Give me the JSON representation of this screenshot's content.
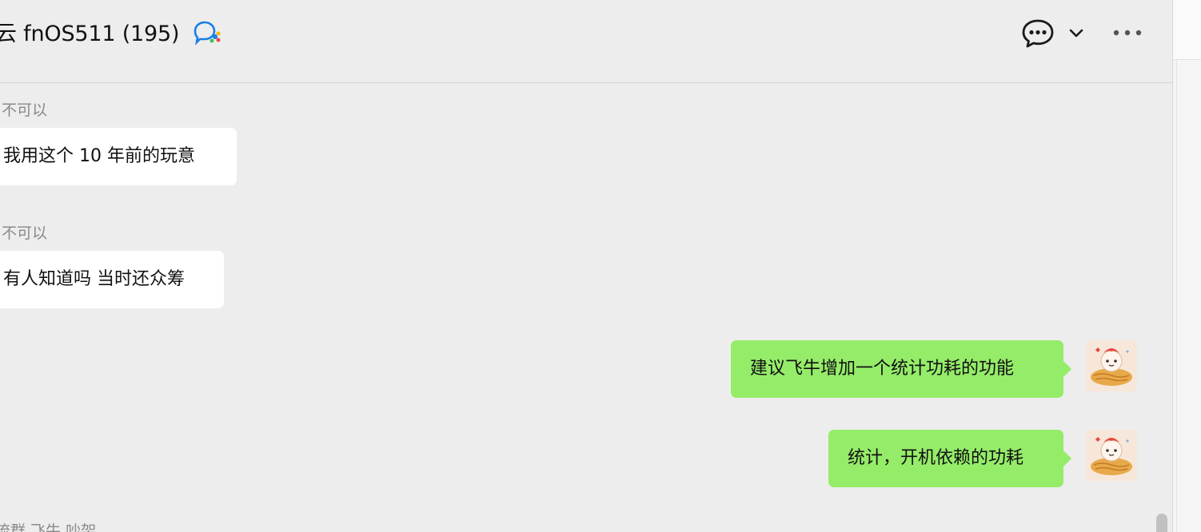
{
  "header": {
    "title": "云 fnOS511 (195)",
    "group_badge_icon": "group-chat-badge-icon",
    "chat_icon": "chat-bubble-icon",
    "chevron_icon": "chevron-down-icon",
    "more_icon": "more-horizontal-icon"
  },
  "messages": [
    {
      "direction": "in",
      "sender": "不可以",
      "text": "我用这个  10 年前的玩意"
    },
    {
      "direction": "in",
      "sender": "不可以",
      "text": "有人知道吗 当时还众筹"
    },
    {
      "direction": "out",
      "text": "建议飞牛增加一个统计功耗的功能",
      "avatar_icon": "peanut-cat-avatar-icon"
    },
    {
      "direction": "out",
      "text": "统计，开机依赖的功耗",
      "avatar_icon": "peanut-cat-avatar-icon"
    }
  ],
  "footer_snippet": "流群  飞牛  吵架",
  "colors": {
    "background": "#ededed",
    "incoming_bubble": "#ffffff",
    "outgoing_bubble": "#95ec69",
    "sender_text": "#8a8a8a"
  }
}
